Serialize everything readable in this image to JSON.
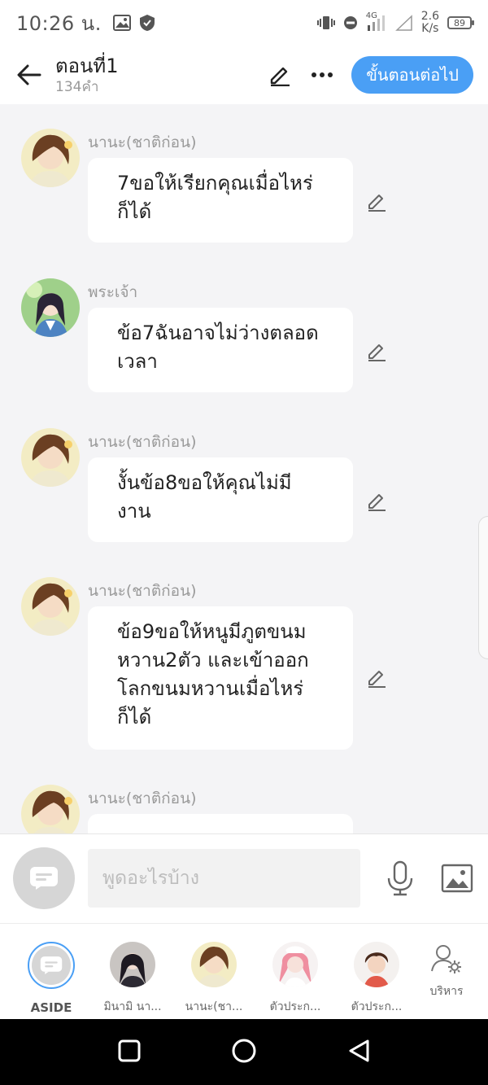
{
  "status_bar": {
    "time": "10:26 น.",
    "network_speed_value": "2.6",
    "network_speed_unit": "K/s",
    "battery": "89",
    "network_type": "4G"
  },
  "header": {
    "title": "ตอนที่1",
    "word_count": "134คำ",
    "next_button": "ขั้นตอนต่อไป"
  },
  "messages": [
    {
      "sender": "นานะ(ชาติก่อน)",
      "lines": [
        "7ขอให้เรียกคุณเมื่อไหร่",
        "ก็ได้"
      ],
      "avatar": "nana"
    },
    {
      "sender": "พระเจ้า",
      "lines": [
        "ข้อ7ฉันอาจไม่ว่างตลอด",
        "เวลา"
      ],
      "avatar": "god"
    },
    {
      "sender": "นานะ(ชาติก่อน)",
      "lines": [
        "งั้นข้อ8ขอให้คุณไม่มี",
        "งาน"
      ],
      "avatar": "nana"
    },
    {
      "sender": "นานะ(ชาติก่อน)",
      "lines": [
        "ข้อ9ขอให้หนูมีภูตขนม",
        "หวาน2ตัว และเข้าออก",
        "โลกขนมหวานเมื่อไหร่",
        "ก็ได้"
      ],
      "avatar": "nana"
    },
    {
      "sender": "นานะ(ชาติก่อน)",
      "lines": [],
      "avatar": "nana"
    }
  ],
  "input": {
    "placeholder": "พูดอะไรบ้าง"
  },
  "characters": [
    {
      "label": "ASIDE"
    },
    {
      "label": "มินามิ นา..."
    },
    {
      "label": "นานะ(ชา..."
    },
    {
      "label": "ตัวประก..."
    },
    {
      "label": "ตัวประก..."
    },
    {
      "label": "บริหาร"
    }
  ],
  "colors": {
    "accent": "#4a9ff5",
    "background": "#f4f4f6",
    "bubble": "#ffffff"
  },
  "icons": {
    "back": "arrow-left-icon",
    "edit": "pencil-icon",
    "more": "more-dots-icon",
    "mic": "microphone-icon",
    "image": "image-icon",
    "manage": "user-settings-icon"
  }
}
